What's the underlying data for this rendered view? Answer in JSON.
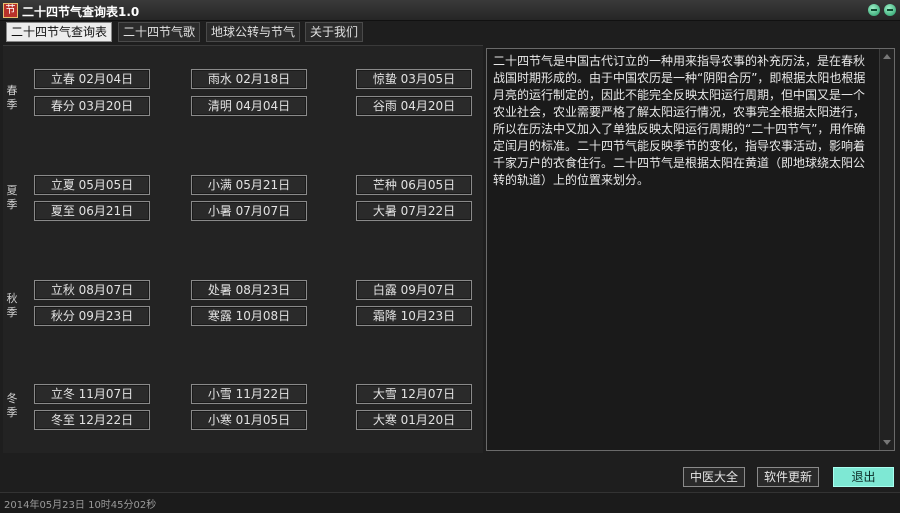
{
  "window": {
    "title": "二十四节气查询表1.0"
  },
  "tabs": [
    {
      "label": "二十四节气查询表",
      "active": true
    },
    {
      "label": "二十四节气歌",
      "active": false
    },
    {
      "label": "地球公转与节气",
      "active": false
    },
    {
      "label": "关于我们",
      "active": false
    }
  ],
  "seasons": [
    {
      "label": "春季",
      "terms": [
        "立春 02月04日",
        "雨水 02月18日",
        "惊蛰 03月05日",
        "春分 03月20日",
        "清明 04月04日",
        "谷雨 04月20日"
      ]
    },
    {
      "label": "夏季",
      "terms": [
        "立夏 05月05日",
        "小满 05月21日",
        "芒种 06月05日",
        "夏至 06月21日",
        "小暑 07月07日",
        "大暑 07月22日"
      ]
    },
    {
      "label": "秋季",
      "terms": [
        "立秋 08月07日",
        "处暑 08月23日",
        "白露 09月07日",
        "秋分 09月23日",
        "寒露 10月08日",
        "霜降 10月23日"
      ]
    },
    {
      "label": "冬季",
      "terms": [
        "立冬 11月07日",
        "小雪 11月22日",
        "大雪 12月07日",
        "冬至 12月22日",
        "小寒 01月05日",
        "大寒 01月20日"
      ]
    }
  ],
  "description": "二十四节气是中国古代订立的一种用来指导农事的补充历法，是在春秋战国时期形成的。由于中国农历是一种“阴阳合历”，即根据太阳也根据月亮的运行制定的，因此不能完全反映太阳运行周期，但中国又是一个农业社会，农业需要严格了解太阳运行情况，农事完全根据太阳进行，所以在历法中又加入了单独反映太阳运行周期的“二十四节气”，用作确定闰月的标准。二十四节气能反映季节的变化，指导农事活动，影响着千家万户的衣食住行。二十四节气是根据太阳在黄道（即地球绕太阳公转的轨道）上的位置来划分。",
  "buttons": {
    "tcm": "中医大全",
    "update": "软件更新",
    "exit": "退出"
  },
  "status": "2014年05月23日 10时45分02秒",
  "colors": {
    "accent": "#7ee8d4",
    "window_bg": "#1e1e1e"
  }
}
